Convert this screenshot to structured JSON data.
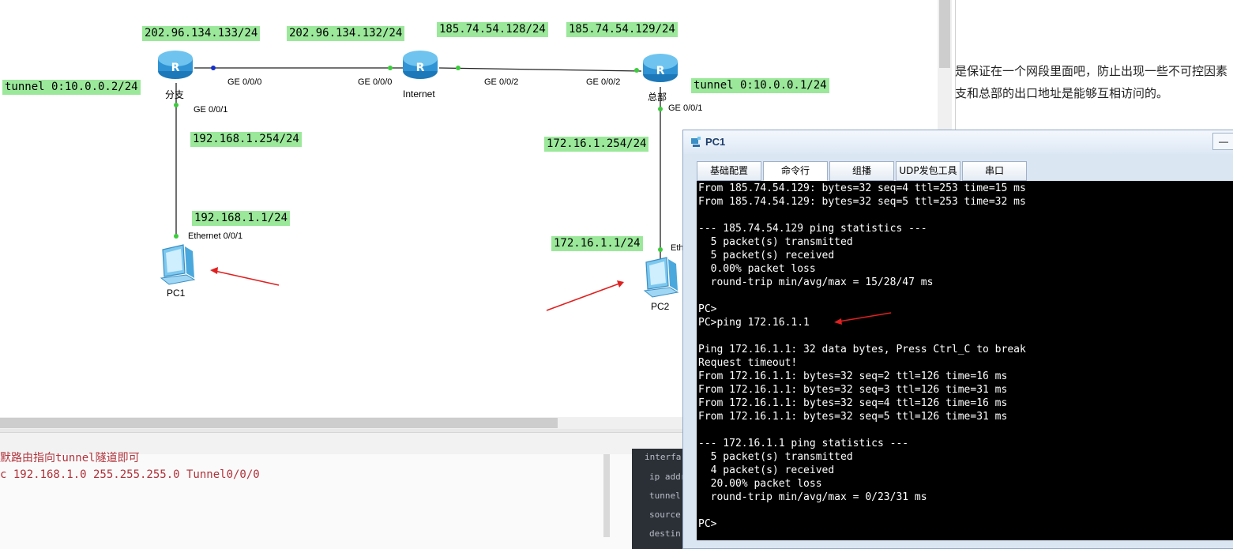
{
  "topology": {
    "devices": {
      "branch_router": "分支",
      "internet_router": "Internet",
      "hq_router": "总部",
      "pc1": "PC1",
      "pc2": "PC2"
    },
    "ip_labels": {
      "branch_ge000": "202.96.134.133/24",
      "internet_ge000": "202.96.134.132/24",
      "internet_ge002": "185.74.54.128/24",
      "hq_ge002": "185.74.54.129/24",
      "branch_tunnel": "tunnel 0:10.0.0.2/24",
      "hq_tunnel": "tunnel 0:10.0.0.1/24",
      "branch_ge001": "192.168.1.254/24",
      "hq_ge001": "172.16.1.254/24",
      "pc1_ip": "192.168.1.1/24",
      "pc2_ip": "172.16.1.1/24"
    },
    "port_labels": {
      "branch_ge000": "GE 0/0/0",
      "internet_ge000": "GE 0/0/0",
      "internet_ge002": "GE 0/0/2",
      "hq_ge002": "GE 0/0/2",
      "branch_ge001": "GE 0/0/1",
      "hq_ge001": "GE 0/0/1",
      "pc1_eth": "Ethernet 0/0/1",
      "pc2_eth": "Eth"
    },
    "colors": {
      "label_bg": "#9be89b",
      "link_dot": "#3dcc3d",
      "arrow": "#e02020",
      "router_blue": "#3aa0d8"
    }
  },
  "doc": {
    "line1": "是保证在一个网段里面吧，防止出现一些不可控因素",
    "line2": "支和总部的出口地址是能够互相访问的。"
  },
  "code_pane": {
    "line1": "默路由指向tunnel隧道即可",
    "line2": "c 192.168.1.0 255.255.255.0 Tunnel0/0/0"
  },
  "dark_pane": {
    "lines": [
      "interfa",
      "ip addr",
      "tunnel",
      "source",
      "destin"
    ]
  },
  "window": {
    "title": "PC1",
    "min_btn": "—",
    "tabs": [
      "基础配置",
      "命令行",
      "组播",
      "UDP发包工具",
      "串口"
    ],
    "active_tab": "命令行",
    "terminal_lines": [
      "From 185.74.54.129: bytes=32 seq=4 ttl=253 time=15 ms",
      "From 185.74.54.129: bytes=32 seq=5 ttl=253 time=32 ms",
      "",
      "--- 185.74.54.129 ping statistics ---",
      "  5 packet(s) transmitted",
      "  5 packet(s) received",
      "  0.00% packet loss",
      "  round-trip min/avg/max = 15/28/47 ms",
      "",
      "PC>",
      "PC>ping 172.16.1.1",
      "",
      "Ping 172.16.1.1: 32 data bytes, Press Ctrl_C to break",
      "Request timeout!",
      "From 172.16.1.1: bytes=32 seq=2 ttl=126 time=16 ms",
      "From 172.16.1.1: bytes=32 seq=3 ttl=126 time=31 ms",
      "From 172.16.1.1: bytes=32 seq=4 ttl=126 time=16 ms",
      "From 172.16.1.1: bytes=32 seq=5 ttl=126 time=31 ms",
      "",
      "--- 172.16.1.1 ping statistics ---",
      "  5 packet(s) transmitted",
      "  4 packet(s) received",
      "  20.00% packet loss",
      "  round-trip min/avg/max = 0/23/31 ms",
      "",
      "PC>"
    ]
  }
}
